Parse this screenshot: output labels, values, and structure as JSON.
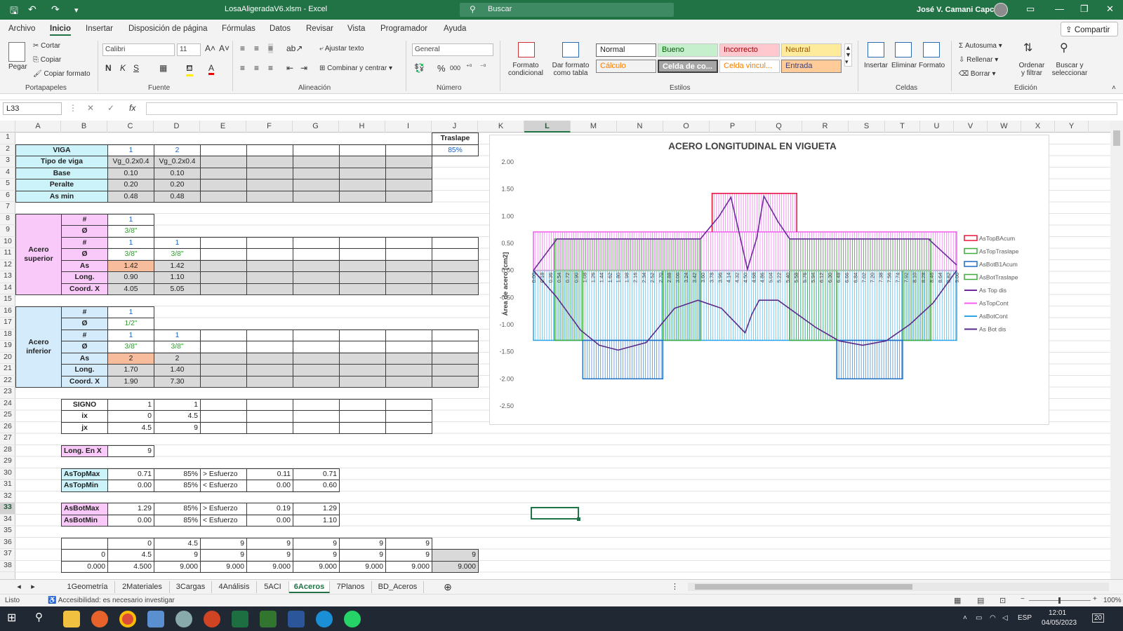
{
  "titlebar": {
    "title": "LosaAligeradaV6.xlsm  -  Excel",
    "search": "Buscar",
    "user": "José V. Camani Capcha"
  },
  "menu": [
    "Archivo",
    "Inicio",
    "Insertar",
    "Disposición de página",
    "Fórmulas",
    "Datos",
    "Revisar",
    "Vista",
    "Programador",
    "Ayuda"
  ],
  "share": "Compartir",
  "ribbon": {
    "paste": "Pegar",
    "cut": "Cortar",
    "copy": "Copiar",
    "format_painter": "Copiar formato",
    "font": "Calibri",
    "size": "11",
    "wrap": "Ajustar texto",
    "merge": "Combinar y centrar",
    "number_format": "General",
    "cond_format": "Formato condicional",
    "table_format": "Dar formato como tabla",
    "styles": {
      "normal": "Normal",
      "bueno": "Bueno",
      "incorrecto": "Incorrecto",
      "neutral": "Neutral",
      "calculo": "Cálculo",
      "celda_co": "Celda de co...",
      "celda_vinc": "Celda vincul...",
      "entrada": "Entrada"
    },
    "insert": "Insertar",
    "delete": "Eliminar",
    "format": "Formato",
    "autosum": "Autosuma",
    "fill": "Rellenar",
    "clear": "Borrar",
    "sort": "Ordenar y filtrar",
    "find": "Buscar y seleccionar",
    "groups": [
      "Portapapeles",
      "Fuente",
      "Alineación",
      "Número",
      "Estilos",
      "Celdas",
      "Edición"
    ]
  },
  "namebox": "L33",
  "columns": [
    "A",
    "B",
    "C",
    "D",
    "E",
    "F",
    "G",
    "H",
    "I",
    "J",
    "K",
    "L",
    "M",
    "N",
    "O",
    "P",
    "Q",
    "R",
    "S",
    "T",
    "U",
    "V",
    "W",
    "X",
    "Y"
  ],
  "rows": [
    "1",
    "2",
    "3",
    "4",
    "5",
    "6",
    "7",
    "8",
    "9",
    "10",
    "11",
    "12",
    "13",
    "14",
    "15",
    "16",
    "17",
    "18",
    "19",
    "20",
    "21",
    "22",
    "23",
    "24",
    "25",
    "26",
    "27",
    "28",
    "29",
    "30",
    "31",
    "32",
    "33",
    "34",
    "35",
    "36",
    "37",
    "38"
  ],
  "sheet": {
    "traslape_label": "Traslape",
    "traslape_value": "85%",
    "viga": {
      "label": "VIGA",
      "c": "1",
      "d": "2"
    },
    "tipo": {
      "label": "Tipo de viga",
      "c": "Vg_0.2x0.4",
      "d": "Vg_0.2x0.4"
    },
    "base": {
      "label": "Base",
      "c": "0.10",
      "d": "0.10"
    },
    "peralte": {
      "label": "Peralte",
      "c": "0.20",
      "d": "0.20"
    },
    "asmin": {
      "label": "As min",
      "c": "0.48",
      "d": "0.48"
    },
    "sup": {
      "label": "Acero superior",
      "r8": [
        "#",
        "1"
      ],
      "r9": [
        "Ø",
        "3/8\""
      ],
      "r10": [
        "#",
        "1",
        "1"
      ],
      "r11": [
        "Ø",
        "3/8\"",
        "3/8\""
      ],
      "r12": [
        "As",
        "1.42",
        "1.42"
      ],
      "r13": [
        "Long.",
        "0.90",
        "1.10"
      ],
      "r14": [
        "Coord. X",
        "4.05",
        "5.05"
      ]
    },
    "inf": {
      "label": "Acero inferior",
      "r16": [
        "#",
        "1"
      ],
      "r17": [
        "Ø",
        "1/2\""
      ],
      "r18": [
        "#",
        "1",
        "1"
      ],
      "r19": [
        "Ø",
        "3/8\"",
        "3/8\""
      ],
      "r20": [
        "As",
        "2",
        "2"
      ],
      "r21": [
        "Long.",
        "1.70",
        "1.40"
      ],
      "r22": [
        "Coord. X",
        "1.90",
        "7.30"
      ]
    },
    "signo": {
      "label": "SIGNO",
      "c": "1",
      "d": "1"
    },
    "ix": {
      "label": "ix",
      "c": "0",
      "d": "4.5"
    },
    "jx": {
      "label": "jx",
      "c": "4.5",
      "d": "9"
    },
    "longx": {
      "label": "Long. En X",
      "c": "9"
    },
    "astopmax": [
      "AsTopMax",
      "0.71",
      "85%",
      "> Esfuerzo",
      "0.11",
      "0.71"
    ],
    "astopmin": [
      "AsTopMin",
      "0.00",
      "85%",
      "< Esfuerzo",
      "0.00",
      "0.60"
    ],
    "asbotmax": [
      "AsBotMax",
      "1.29",
      "85%",
      "> Esfuerzo",
      "0.19",
      "1.29"
    ],
    "asbotmin": [
      "AsBotMin",
      "0.00",
      "85%",
      "< Esfuerzo",
      "0.00",
      "1.10"
    ],
    "r36": [
      "0",
      "4.5",
      "9",
      "9",
      "9",
      "9",
      "9"
    ],
    "r37": [
      "0",
      "4.5",
      "9",
      "9",
      "9",
      "9",
      "9",
      "9",
      "9"
    ],
    "r38": [
      "0.000",
      "4.500",
      "9.000",
      "9.000",
      "9.000",
      "9.000",
      "9.000",
      "9.000",
      "9.000"
    ]
  },
  "chart_data": {
    "type": "area",
    "title": "ACERO LONGITUDINAL EN VIGUETA",
    "ylabel": "Área de acero [cm2]",
    "ylim": [
      -2.5,
      2.0
    ],
    "yticks": [
      "2.00",
      "1.50",
      "1.00",
      "0.50",
      "0.00",
      "-0.50",
      "-1.00",
      "-1.50",
      "-2.00",
      "-2.50"
    ],
    "xlabels": [
      "0.00",
      "0.18",
      "0.36",
      "0.54",
      "0.72",
      "0.90",
      "1.08",
      "1.26",
      "1.44",
      "1.62",
      "1.80",
      "1.98",
      "2.16",
      "2.34",
      "2.52",
      "2.70",
      "2.88",
      "3.06",
      "3.24",
      "3.42",
      "3.60",
      "3.78",
      "3.96",
      "4.14",
      "4.32",
      "4.50",
      "4.68",
      "4.86",
      "5.04",
      "5.22",
      "5.40",
      "5.58",
      "5.76",
      "5.94",
      "6.12",
      "6.30",
      "6.48",
      "6.66",
      "6.84",
      "7.02",
      "7.20",
      "7.38",
      "7.56",
      "7.74",
      "7.92",
      "8.10",
      "8.28",
      "8.46",
      "8.64",
      "8.82",
      "9.00"
    ],
    "legend": [
      "AsTopBAcum",
      "AsTopTraslape",
      "AsBotB1Acum",
      "AsBotTraslape",
      "As Top dis",
      "AsTopCont",
      "AsBotCont",
      "As Bot dis"
    ],
    "colors": {
      "AsTopBAcum": "#e8173b",
      "AsTopTraslape": "#3faa3f",
      "AsBotB1Acum": "#1f6fc4",
      "AsBotTraslape": "#3faa3f",
      "As Top dis": "#6a2c9a",
      "AsTopCont": "#f15ef1",
      "AsBotCont": "#2aa6e6",
      "As Bot dis": "#5a2a8a"
    },
    "series": [
      {
        "name": "AsTopCont",
        "x": [
          0,
          9
        ],
        "values": [
          0.71,
          0.71
        ]
      },
      {
        "name": "AsTopBAcum",
        "x": [
          3.8,
          5.6
        ],
        "values": [
          1.42,
          1.42
        ]
      },
      {
        "name": "AsBotCont",
        "x": [
          0,
          9
        ],
        "values": [
          -1.29,
          -1.29
        ]
      },
      {
        "name": "AsBotB1Acum",
        "x": [
          1.05,
          2.75,
          6.45,
          7.85
        ],
        "values": [
          -2.0,
          -2.0,
          -2.0,
          -2.0
        ]
      },
      {
        "name": "As Top dis",
        "x": [
          0,
          0.5,
          3.55,
          3.95,
          4.2,
          4.4,
          4.55,
          4.75,
          4.9,
          5.2,
          5.45,
          8.4,
          9
        ],
        "values": [
          0,
          0.58,
          0.58,
          1.0,
          1.35,
          0.6,
          0.02,
          0.6,
          1.37,
          0.9,
          0.58,
          0.58,
          0.1
        ]
      },
      {
        "name": "As Bot dis",
        "x": [
          0,
          0.5,
          1.0,
          1.4,
          1.8,
          2.4,
          3.0,
          3.5,
          4.0,
          4.5,
          4.65,
          4.8,
          5.2,
          6.0,
          6.5,
          7.0,
          7.5,
          8.0,
          8.5,
          9
        ],
        "values": [
          0,
          -0.5,
          -1.1,
          -1.38,
          -1.47,
          -1.33,
          -0.7,
          -0.55,
          -0.7,
          -1.15,
          -0.8,
          -0.55,
          -0.55,
          -1.05,
          -1.3,
          -1.38,
          -1.3,
          -1.0,
          -0.6,
          0
        ]
      }
    ]
  },
  "tabs": [
    "1Geometría",
    "2Materiales",
    "3Cargas",
    "4Análisis",
    "5ACI",
    "6Aceros",
    "7Planos",
    "BD_Aceros"
  ],
  "active_tab": "6Aceros",
  "status": {
    "ready": "Listo",
    "accessibility": "Accesibilidad: es necesario investigar",
    "zoom": "100%"
  },
  "taskbar": {
    "lang": "ESP",
    "time": "12:01",
    "date": "04/05/2023",
    "notif": "20"
  }
}
